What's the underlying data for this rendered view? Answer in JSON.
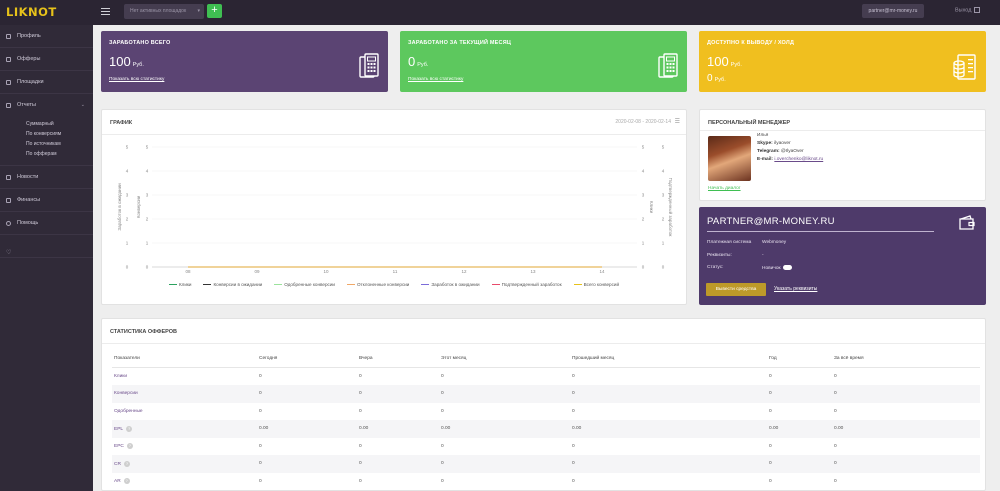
{
  "app": {
    "logo": "LIKNOT"
  },
  "topbar": {
    "site_select_placeholder": "Нет активных площадок",
    "add_label": "+",
    "account_email": "partner@mr-money.ru",
    "logout_label": "Выход"
  },
  "sidebar": {
    "items": [
      {
        "label": "Профиль",
        "icon": "user-icon"
      },
      {
        "label": "Офферы",
        "icon": "folder-icon"
      },
      {
        "label": "Площадки",
        "icon": "grid-icon"
      },
      {
        "label": "Отчеты",
        "icon": "chart-icon"
      },
      {
        "label": "Новости",
        "icon": "news-icon"
      },
      {
        "label": "Финансы",
        "icon": "money-icon"
      },
      {
        "label": "Помощь",
        "icon": "help-icon"
      },
      {
        "label": "",
        "icon": "heart-icon"
      }
    ],
    "reports_sub": [
      "Суммарный",
      "По конверсиям",
      "По источникам",
      "По офферам"
    ]
  },
  "stats": {
    "earned_total": {
      "title": "ЗАРАБОТАНО ВСЕГО",
      "value": "100",
      "unit": "Руб.",
      "link": "Показать всю статистику",
      "color": "#5b4473"
    },
    "earned_month": {
      "title": "ЗАРАБОТАНО ЗА ТЕКУЩИЙ МЕСЯЦ",
      "value": "0",
      "unit": "Руб.",
      "link": "Показать всю статистику",
      "color": "#5dc85e"
    },
    "available": {
      "title": "ДОСТУПНО К ВЫВОДУ / ХОЛД",
      "value": "100",
      "unit": "Руб.",
      "value2": "0",
      "unit2": "Руб.",
      "color": "#f0bf1f"
    }
  },
  "chart_panel": {
    "title": "ГРАФИК",
    "date_range": "2020-02-08 - 2020-02-14"
  },
  "chart_data": {
    "type": "line",
    "categories": [
      "08",
      "09",
      "10",
      "11",
      "12",
      "13",
      "14"
    ],
    "series": [
      {
        "name": "Клики",
        "values": [
          0,
          0,
          0,
          0,
          0,
          0,
          0
        ],
        "color": "#2ca25f"
      },
      {
        "name": "Конверсии в ожидании",
        "values": [
          0,
          0,
          0,
          0,
          0,
          0,
          0
        ],
        "color": "#333333"
      },
      {
        "name": "Одобренные конверсии",
        "values": [
          0,
          0,
          0,
          0,
          0,
          0,
          0
        ],
        "color": "#9be39c"
      },
      {
        "name": "Отклоненные конверсии",
        "values": [
          0,
          0,
          0,
          0,
          0,
          0,
          0
        ],
        "color": "#f0a868"
      },
      {
        "name": "Заработок в ожидании",
        "values": [
          0,
          0,
          0,
          0,
          0,
          0,
          0
        ],
        "color": "#7b6cd9"
      },
      {
        "name": "Подтвержденный заработок",
        "values": [
          0,
          0,
          0,
          0,
          0,
          0,
          0
        ],
        "color": "#e84b6b"
      },
      {
        "name": "Всего конверсий",
        "values": [
          0,
          0,
          0,
          0,
          0,
          0,
          0
        ],
        "color": "#e7c21a"
      }
    ],
    "y_ticks": [
      "0",
      "1",
      "2",
      "3",
      "4",
      "5"
    ],
    "ylim": [
      0,
      5
    ],
    "axis_labels": {
      "left_outer": "Заработок в ожидании",
      "left_inner": "Конверсии",
      "right_inner": "Клики",
      "right_outer": "Подтвержденный заработок"
    },
    "legend_position": "bottom"
  },
  "manager": {
    "title": "ПЕРСОНАЛЬНЫЙ МЕНЕДЖЕР",
    "name": "Илья",
    "skype_label": "Skype:",
    "skype": "ilyaover",
    "telegram_label": "Telegram:",
    "telegram": "@IlyaOver",
    "email_label": "E-mail:",
    "email": "i.overchenko@liknot.ru",
    "link": "Начать диалог"
  },
  "partner": {
    "title": "PARTNER@MR-MONEY.RU",
    "payment_label": "Платежная система",
    "payment_value": "Webmoney",
    "requisites_label": "Реквизиты:",
    "requisites_value": "-",
    "status_label": "Статус:",
    "status_value": "Новичок",
    "withdraw_button": "Вывести средства",
    "requisites_link": "Указать реквизиты"
  },
  "offers": {
    "title": "СТАТИСТИКА ОФФЕРОВ",
    "headers": [
      "Показатели",
      "Сегодня",
      "Вчера",
      "Этот месяц",
      "Прошедший месяц",
      "Год",
      "За всё время"
    ],
    "rows": [
      {
        "label": "Клики",
        "help": false,
        "values": [
          "0",
          "0",
          "0",
          "0",
          "0",
          "0"
        ]
      },
      {
        "label": "Конверсии",
        "help": false,
        "values": [
          "0",
          "0",
          "0",
          "0",
          "0",
          "0"
        ]
      },
      {
        "label": "Одобренные",
        "help": false,
        "values": [
          "0",
          "0",
          "0",
          "0",
          "0",
          "0"
        ]
      },
      {
        "label": "EPL",
        "help": true,
        "values": [
          "0.00",
          "0.00",
          "0.00",
          "0.00",
          "0.00",
          "0.00"
        ]
      },
      {
        "label": "EPC",
        "help": true,
        "values": [
          "0",
          "0",
          "0",
          "0",
          "0",
          "0"
        ]
      },
      {
        "label": "CR",
        "help": true,
        "values": [
          "0",
          "0",
          "0",
          "0",
          "0",
          "0"
        ]
      },
      {
        "label": "AR",
        "help": true,
        "values": [
          "0",
          "0",
          "0",
          "0",
          "0",
          "0"
        ]
      }
    ],
    "help_glyph": "?"
  }
}
